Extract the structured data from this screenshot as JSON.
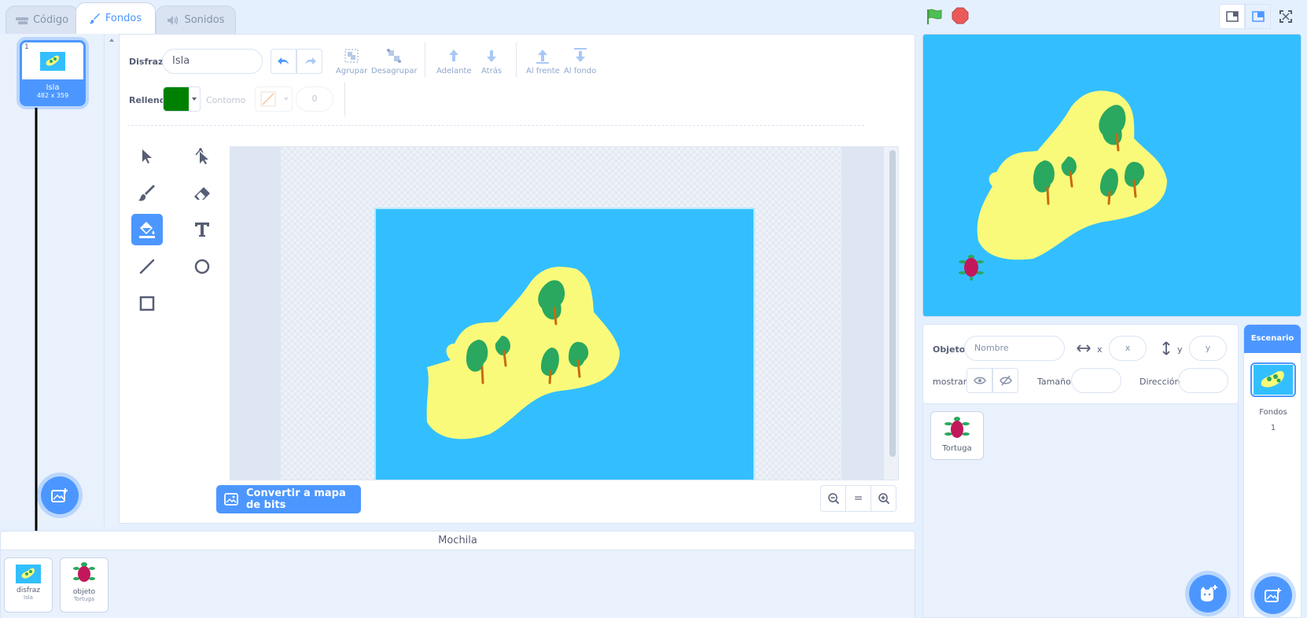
{
  "tabs": [
    {
      "label": "Código",
      "icon": "code-icon"
    },
    {
      "label": "Fondos",
      "icon": "paintbrush-icon"
    },
    {
      "label": "Sonidos",
      "icon": "sound-icon"
    }
  ],
  "costumes": [
    {
      "number": "1",
      "name": "Isla",
      "size": "482 x 359"
    }
  ],
  "editor": {
    "costume_label": "Disfraz",
    "costume_name": "Isla",
    "buttons": {
      "group": "Agrupar",
      "ungroup": "Desagrupar",
      "forward": "Adelante",
      "backward": "Atrás",
      "front": "Al frente",
      "back": "Al fondo"
    },
    "fill_label": "Relleno",
    "fill_color": "#008000",
    "outline_label": "Contorno",
    "outline_width": "0",
    "convert_label": "Convertir a mapa de bits",
    "zoom_reset": "="
  },
  "backpack": {
    "title": "Mochila",
    "items": [
      {
        "type": "disfraz",
        "name": "Isla"
      },
      {
        "type": "objeto",
        "name": "Tortuga"
      }
    ]
  },
  "sprite_info": {
    "object_label": "Objeto",
    "name_placeholder": "Nombre",
    "x_label": "x",
    "x_placeholder": "x",
    "y_label": "y",
    "y_placeholder": "y",
    "show_label": "mostrar",
    "size_label": "Tamaño",
    "direction_label": "Dirección"
  },
  "sprites": [
    {
      "name": "Tortuga"
    }
  ],
  "stage_target": {
    "title": "Escenario",
    "backdrops_label": "Fondos",
    "backdrops_count": "1"
  },
  "colors": {
    "accent": "#4c97ff",
    "stage_water": "#33bfff",
    "island": "#fafa7a",
    "tree": "#2aa85f",
    "turtle_shell": "#c2185b"
  }
}
